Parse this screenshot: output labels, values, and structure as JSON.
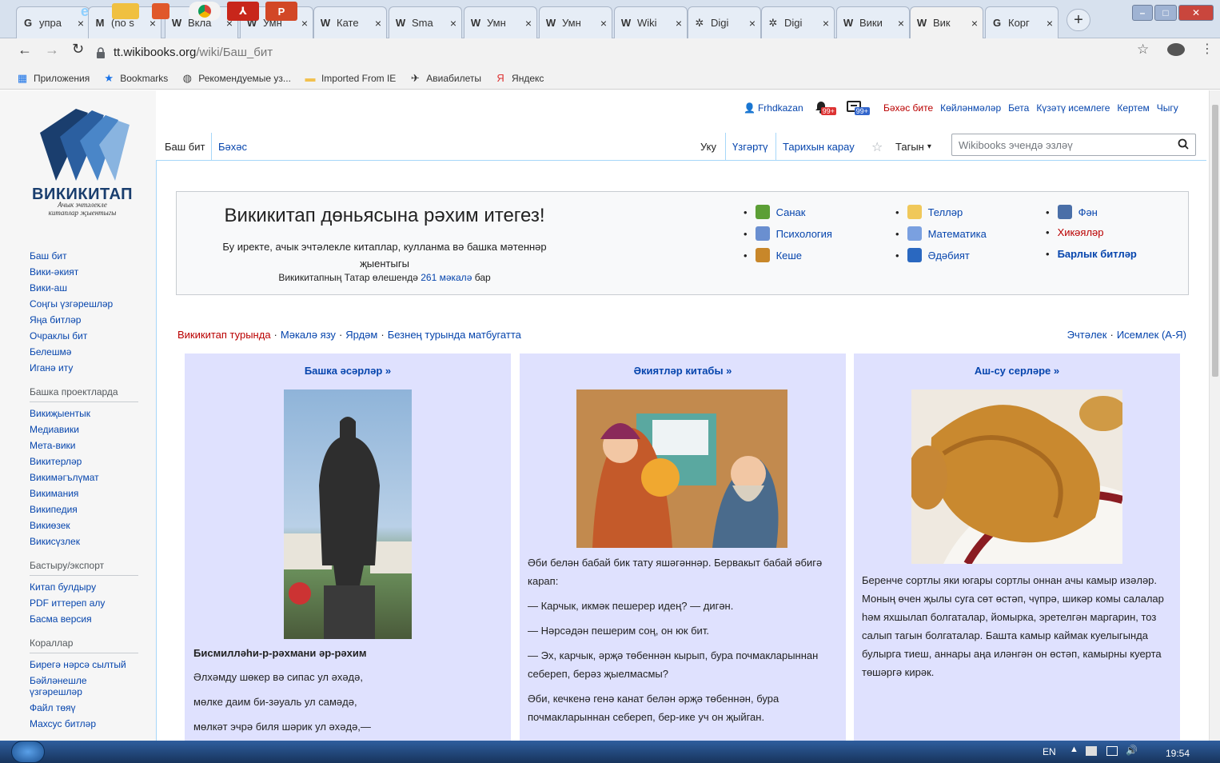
{
  "browser": {
    "tabs": [
      {
        "title": "упра",
        "icon": "G"
      },
      {
        "title": "(no s",
        "icon": "M"
      },
      {
        "title": "Вкла",
        "icon": "W"
      },
      {
        "title": "Умн",
        "icon": "W"
      },
      {
        "title": "Кате",
        "icon": "W"
      },
      {
        "title": "Sma",
        "icon": "W"
      },
      {
        "title": "Умн",
        "icon": "W"
      },
      {
        "title": "Умн",
        "icon": "W"
      },
      {
        "title": "Wiki",
        "icon": "W"
      },
      {
        "title": "Digi",
        "icon": "✲"
      },
      {
        "title": "Digi",
        "icon": "✲"
      },
      {
        "title": "Вики",
        "icon": "W"
      },
      {
        "title": "Вик",
        "icon": "W"
      },
      {
        "title": "Корг",
        "icon": "G"
      }
    ],
    "new_tab": "+",
    "close": "×",
    "url_host": "tt.wikibooks.org",
    "url_path": "/wiki/Баш_бит",
    "bookmarks": [
      {
        "label": "Приложения",
        "icon": "grid-icon"
      },
      {
        "label": "Bookmarks",
        "icon": "star-icon"
      },
      {
        "label": "Рекомендуемые уз...",
        "icon": "globe-icon"
      },
      {
        "label": "Imported From IE",
        "icon": "folder-icon"
      },
      {
        "label": "Авиабилеты",
        "icon": "plane-icon"
      },
      {
        "label": "Яндекс",
        "icon": "yandex-icon"
      }
    ]
  },
  "logo": {
    "title": "ВИКИКИТАП",
    "sub1": "Ачык эчтәлекле",
    "sub2": "китаплар җыентыгы"
  },
  "personal": {
    "user": "Frhdkazan",
    "notif_badge": "99+",
    "alert_badge": "99+",
    "links": [
      "Бәхәс бите",
      "Көйләнмәләр",
      "Бета",
      "Күзәтү исемлеге",
      "Кертем",
      "Чыгу"
    ]
  },
  "tabs_left": [
    "Баш бит",
    "Бәхәс"
  ],
  "tabs_right": [
    "Уку",
    "Үзгәртү",
    "Тарихын карау"
  ],
  "more_menu": "Тагын",
  "search_placeholder": "Wikibooks эчендә эзләү",
  "sidebar": {
    "main": [
      "Баш бит",
      "Вики-әкият",
      "Вики-аш",
      "Соңгы үзгәрешләр",
      "Яңа битләр",
      "Очраклы бит",
      "Белешмә",
      "Иганә иту"
    ],
    "projects_head": "Башка проектларда",
    "projects": [
      "Викиҗыентык",
      "Медиавики",
      "Мета-вики",
      "Викитерләр",
      "Викимәгълүмат",
      "Викимания",
      "Википедия",
      "Викиөзек",
      "Викисүзлек"
    ],
    "export_head": "Бастыру/экспорт",
    "export": [
      "Китап булдыру",
      "PDF иттереп алу",
      "Басма версия"
    ],
    "tools_head": "Кораллар",
    "tools": [
      "Бирегә нәрсә сылтый",
      "Бәйләнешле үзгәрешләр",
      "Файл төяү",
      "Махсус битләр"
    ]
  },
  "welcome": {
    "title": "Викикитап дөньясына рәхим итегез!",
    "desc": "Бу иректе, ачык эчтәлекле китаплар, кулланма вә башка мәтеннәр җыентыгы",
    "count_pre": "Викикитапның Татар өлешендә",
    "count_link": "261 мәкалә",
    "count_post": "бар"
  },
  "portals": {
    "col1": [
      "Санак",
      "Психология",
      "Кеше"
    ],
    "col2": [
      "Телләр",
      "Математика",
      "Әдәбият"
    ],
    "col3": [
      "Фән",
      "Хикәяләр",
      "Барлык битләр"
    ]
  },
  "linkbar": {
    "left": [
      "Викикитап турында",
      "Мәкалә язу",
      "Ярдәм",
      "Безнең турында матбугатта"
    ],
    "right": [
      "Эчтәлек",
      "Исемлек (А-Я)"
    ],
    "sep": "·"
  },
  "boxes": [
    {
      "title": "Башка әсәрләр »",
      "caption": "Бисмилләһи-р-рәхмани әр-рәхим",
      "lines": [
        "Әлхәмду шөкер вә сипас ул әхәдә,",
        "мөлке даим би-зәуаль ул самәдә,",
        "мөлкәт эчрә биля шәрик ул әхәдә,—"
      ]
    },
    {
      "title": "Әкиятләр китабы »",
      "lines": [
        "Әби белән бабай бик тату яшәгәннәр. Бервакыт бабай әбигә карап:",
        "— Карчык, икмәк пешерер идең? — дигән.",
        "— Нәрсәдән пешерим соң, он юк бит.",
        "— Эх, карчык, әрҗә төбеннән кырып, бура почмакларыннан себереп, берәз җыелмасмы?",
        "Әби, кечкенә генә канат белән әрҗә төбеннән, бура почмакларыннан себереп, бер-ике уч он җыйган."
      ]
    },
    {
      "title": "Аш-су серләре »",
      "lines": [
        "Беренче сортлы яки югары сортлы оннан ачы камыр изәләр. Моның өчен җылы суга сөт өстәп, чүпрә, шикәр комы салалар һәм яхшылап болгаталар, йомырка, эретелгән маргарин, тоз салып тагын болгаталар. Башта камыр каймак куелыгында булырга тиеш, аннары аңа иләнгән он өстәп, камырны куерта төшәргә кирәк."
      ]
    }
  ],
  "taskbar": {
    "lang": "EN",
    "time": "19:54"
  },
  "colors": {
    "link": "#0645ad",
    "portal_box": "#dfe1fe",
    "red_link": "#ba0000"
  }
}
